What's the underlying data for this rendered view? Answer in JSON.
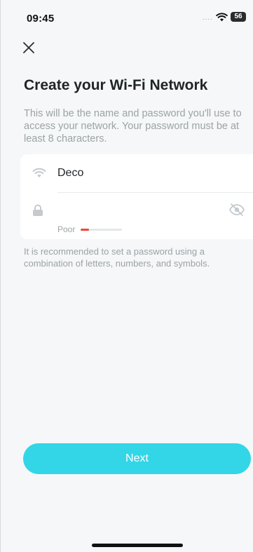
{
  "status_bar": {
    "time": "09:45",
    "signal": "....",
    "battery": "56"
  },
  "header": {
    "close_icon": "close-icon"
  },
  "page": {
    "title": "Create your Wi-Fi Network",
    "description": "This will be the name and password you'll use to access your network. Your password must be at least 8 characters.",
    "hint": "It is recommended to set a password using a combination of letters, numbers, and symbols."
  },
  "form": {
    "ssid": {
      "icon": "wifi-icon",
      "value": "Deco"
    },
    "password": {
      "icon": "lock-icon",
      "value": "",
      "toggle_icon": "eye-slash-icon",
      "strength_label": "Poor",
      "strength_level": 0.2,
      "strength_color": "#f0453a"
    }
  },
  "actions": {
    "next_label": "Next",
    "next_color": "#33d6e6"
  },
  "colors": {
    "background": "#f5f7f8",
    "card": "#ffffff",
    "title": "#1f2427",
    "muted": "#9ca3a7"
  }
}
